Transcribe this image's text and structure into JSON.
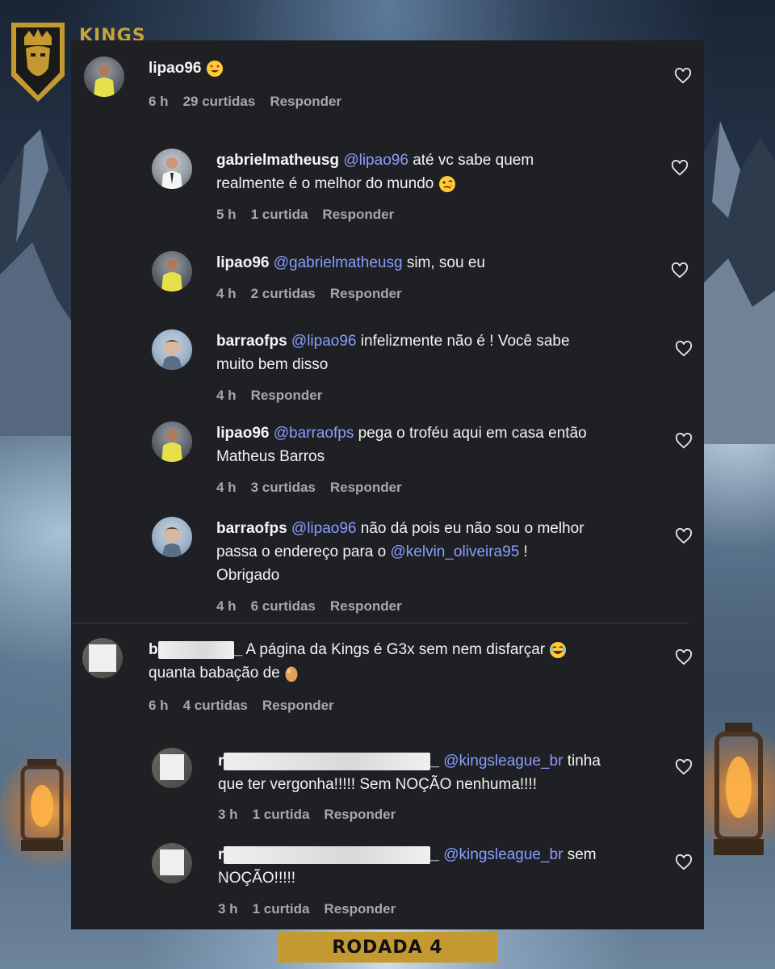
{
  "brand": {
    "name": "KINGS"
  },
  "comments": [
    {
      "username": "lipao96",
      "text": "",
      "emoji": "grinning-hearts-emoji",
      "meta": {
        "time": "6 h",
        "likes": "29 curtidas",
        "reply": "Responder"
      }
    },
    {
      "username": "gabrielmatheusg",
      "mention": "@lipao96",
      "text_line1": "até vc sabe quem",
      "text_line2": "realmente é o melhor do mundo",
      "emoji": "woozy-face-emoji",
      "meta": {
        "time": "5 h",
        "likes": "1 curtida",
        "reply": "Responder"
      }
    },
    {
      "username": "lipao96",
      "mention": "@gabrielmatheusg",
      "text_line1": "sim, sou eu",
      "meta": {
        "time": "4 h",
        "likes": "2 curtidas",
        "reply": "Responder"
      }
    },
    {
      "username": "barraofps",
      "mention": "@lipao96",
      "text_line1": "infelizmente não é ! Você sabe",
      "text_line2": "muito bem disso",
      "meta": {
        "time": "4 h",
        "reply": "Responder"
      }
    },
    {
      "username": "lipao96",
      "mention": "@barraofps",
      "text_line1": "pega o troféu aqui em casa então",
      "text_line2": "Matheus Barros",
      "meta": {
        "time": "4 h",
        "likes": "3 curtidas",
        "reply": "Responder"
      }
    },
    {
      "username": "barraofps",
      "mention": "@lipao96",
      "text_line1": "não dá pois eu não sou o melhor",
      "text_line2a": "passa o endereço para o",
      "mention2": "@kelvin_oliveira95",
      "text_line2b": "!",
      "text_line3": "Obrigado",
      "meta": {
        "time": "4 h",
        "likes": "6 curtidas",
        "reply": "Responder"
      }
    },
    {
      "username_prefix": "b",
      "username_suffix": "_",
      "text_line1": "A página da Kings é G3x sem nem disfarçar",
      "text_line2": "quanta babação de",
      "emoji": "laughing-emoji",
      "emoji2": "egg-emoji",
      "meta": {
        "time": "6 h",
        "likes": "4 curtidas",
        "reply": "Responder"
      }
    },
    {
      "username_prefix": "r",
      "username_suffix": "_",
      "mention": "@kingsleague_br",
      "text_line1": "tinha",
      "text_line2": "que ter vergonha!!!!! Sem NOÇÃO nenhuma!!!!",
      "meta": {
        "time": "3 h",
        "likes": "1 curtida",
        "reply": "Responder"
      }
    },
    {
      "username_prefix": "r",
      "username_suffix": "_",
      "mention": "@kingsleague_br",
      "text_line1": "sem",
      "text_line2": "NOÇÃO!!!!!",
      "meta": {
        "time": "3 h",
        "likes": "1 curtida",
        "reply": "Responder"
      }
    }
  ],
  "footer": {
    "label": "RODADA 4"
  },
  "colors": {
    "accent_gold": "#c49a30",
    "mention_blue": "#8a9dff",
    "panel_bg": "#1f2024"
  }
}
